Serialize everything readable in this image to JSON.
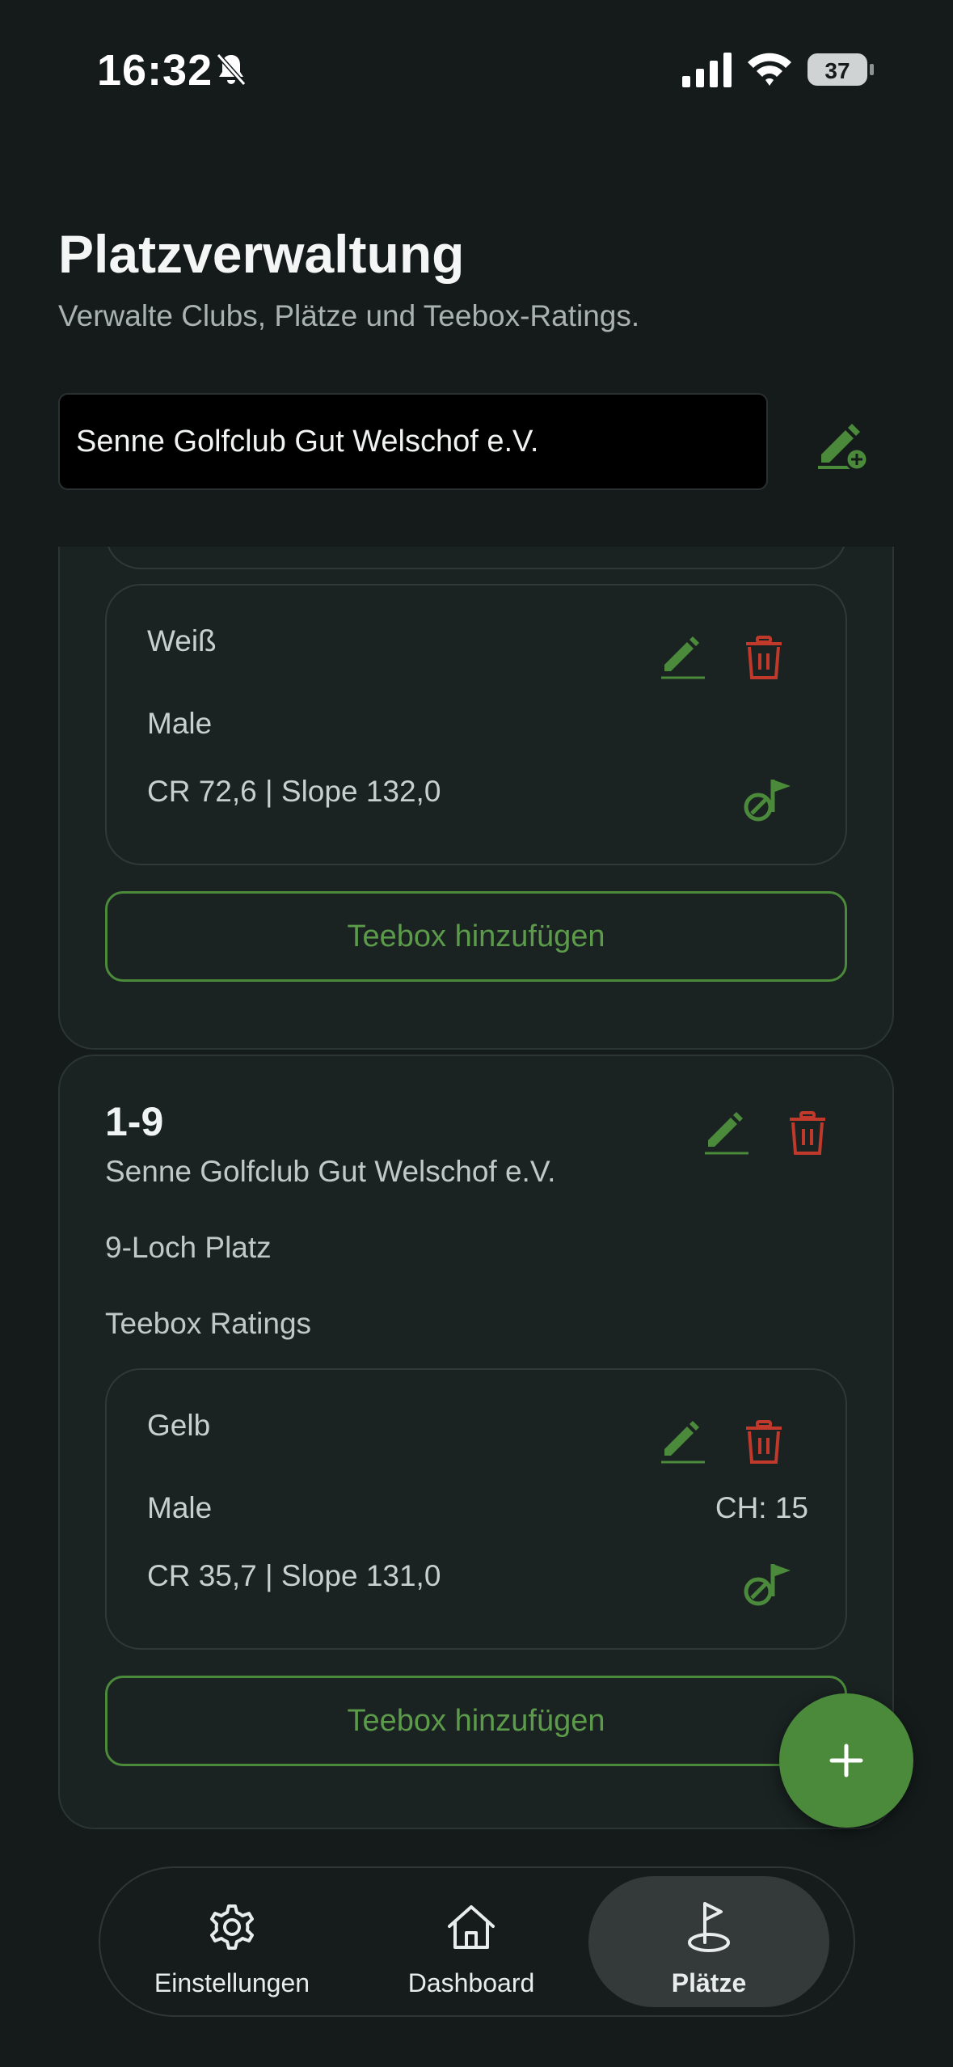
{
  "status": {
    "time": "16:32",
    "battery": "37"
  },
  "header": {
    "title": "Platzverwaltung",
    "subtitle": "Verwalte Clubs, Plätze und Teebox-Ratings."
  },
  "club_select": {
    "value": "Senne Golfclub Gut Welschof e.V."
  },
  "course_prev": {
    "teebox": {
      "name": "Weiß",
      "gender": "Male",
      "rating": "CR 72,6 | Slope 132,0"
    },
    "add_teebox_label": "Teebox hinzufügen"
  },
  "course": {
    "title": "1-9",
    "club": "Senne Golfclub Gut Welschof e.V.",
    "type": "9-Loch Platz",
    "section_label": "Teebox Ratings",
    "teebox": {
      "name": "Gelb",
      "gender": "Male",
      "ch": "CH: 15",
      "rating": "CR 35,7 | Slope 131,0"
    },
    "add_teebox_label": "Teebox hinzufügen"
  },
  "nav": {
    "items": [
      {
        "label": "Einstellungen",
        "icon": "gear-icon"
      },
      {
        "label": "Dashboard",
        "icon": "home-icon"
      },
      {
        "label": "Plätze",
        "icon": "golf-flag-icon"
      }
    ],
    "active": "Plätze"
  },
  "colors": {
    "accent": "#4a8a3a",
    "delete": "#c0392b",
    "background": "#151b1b"
  }
}
